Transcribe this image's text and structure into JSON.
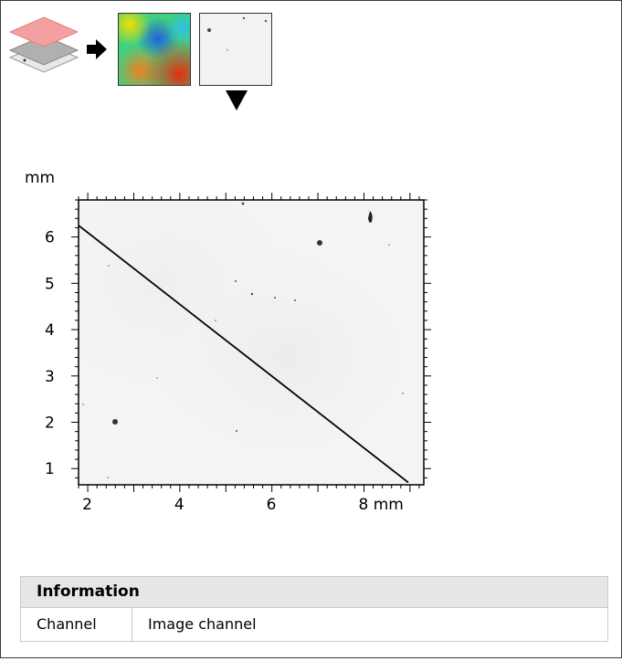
{
  "toolbar": {
    "icons": [
      "layers-icon",
      "arrow-right-icon",
      "color-map-thumbnail",
      "grayscale-thumbnail",
      "arrow-down-icon"
    ]
  },
  "chart_data": {
    "type": "image",
    "x_unit": "mm",
    "y_unit": "mm",
    "xlim": [
      1.8,
      9.3
    ],
    "ylim": [
      0.65,
      6.8
    ],
    "x_ticks": [
      2,
      4,
      6,
      8
    ],
    "x_tick_labels": [
      "2",
      "4",
      "6",
      "8 mm"
    ],
    "y_ticks": [
      1,
      2,
      3,
      4,
      5,
      6
    ],
    "y_tick_labels": [
      "1",
      "2",
      "3",
      "4",
      "5",
      "6"
    ],
    "y_axis_title": "mm",
    "profile_line": {
      "start": [
        1.8,
        6.25
      ],
      "end": [
        9.4,
        0.7
      ]
    }
  },
  "info": {
    "title": "Information",
    "rows": [
      {
        "key": "Channel",
        "value": "Image channel"
      }
    ]
  },
  "colors": {
    "border": "#3a3a3a",
    "header_bg": "#e6e6e6",
    "grid_border": "#c8c8c8"
  }
}
